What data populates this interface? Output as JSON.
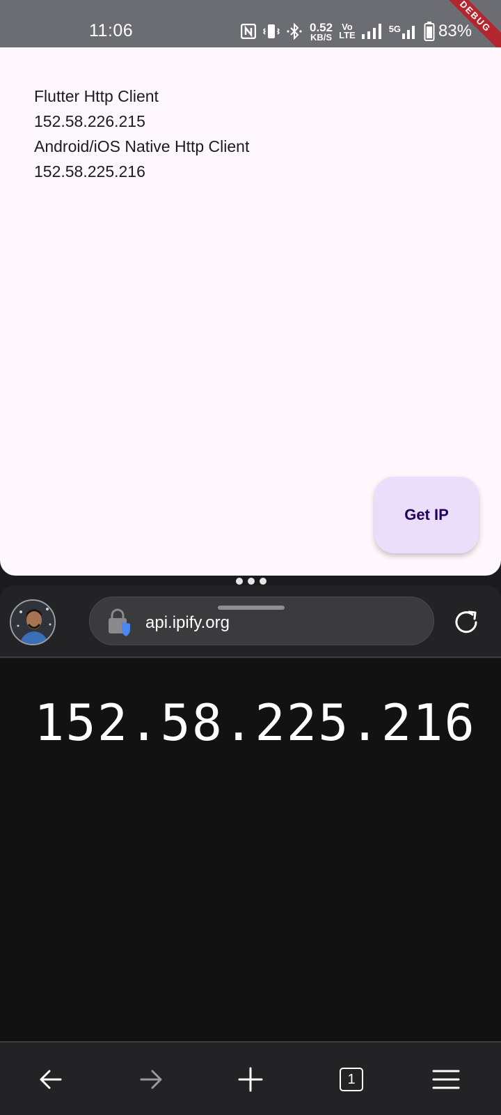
{
  "status_bar": {
    "time": "11:06",
    "net_speed_value": "0.52",
    "net_speed_unit": "KB/S",
    "volte_top": "Vo",
    "volte_bottom": "LTE",
    "network_label": "5G",
    "battery": "83%",
    "debug_banner": "DEBUG",
    "icons": [
      "nfc-icon",
      "vibrate-icon",
      "bluetooth-icon",
      "signal-icon",
      "battery-icon"
    ]
  },
  "app": {
    "lines": [
      "Flutter Http Client",
      "152.58.226.215",
      "Android/iOS Native Http Client",
      "152.58.225.216"
    ],
    "button_label": "Get IP",
    "colors": {
      "background": "#fef7fb",
      "button": "#ebdefb",
      "button_text": "#21005d"
    }
  },
  "browser": {
    "url": "api.ipify.org",
    "page_text": "152.58.225.216",
    "tab_count": "1",
    "nav_icons": [
      "back-arrow-icon",
      "forward-arrow-icon",
      "plus-icon",
      "tab-count-icon",
      "menu-icon"
    ]
  }
}
